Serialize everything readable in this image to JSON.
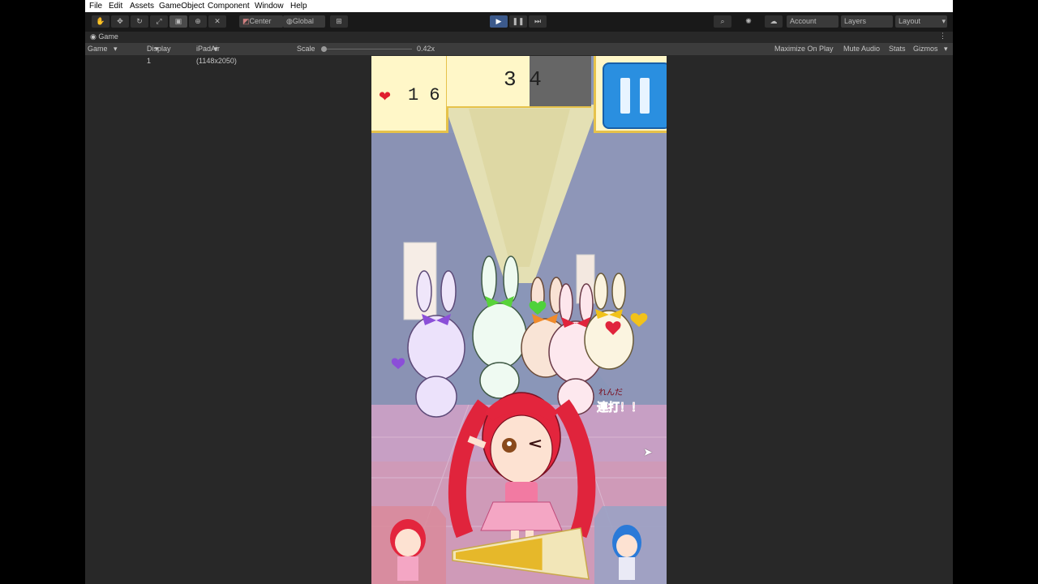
{
  "menu": [
    "File",
    "Edit",
    "Assets",
    "GameObject",
    "Component",
    "Window",
    "Help"
  ],
  "toolbar": {
    "pivot_label": "Center",
    "space_label": "Global",
    "account_label": "Account",
    "layers_label": "Layers",
    "layout_label": "Layout"
  },
  "game_view": {
    "tab_label": "Game",
    "view_select": "Game",
    "display_select": "Display 1",
    "resolution_select": "iPadAir (1148x2050)",
    "scale_label": "Scale",
    "scale_value": "0.42x",
    "maximize_label": "Maximize On Play",
    "mute_label": "Mute Audio",
    "stats_label": "Stats",
    "gizmos_label": "Gizmos"
  },
  "hud": {
    "lives_count": "1 6",
    "score": "3 4",
    "combo_text_top": "れんだ",
    "combo_text_main": "連打！！",
    "tap_gauge_level": 0.7
  },
  "colors": {
    "accent_play": "#3c5a8c",
    "hud_panel": "#fff7c8",
    "pause_blue": "#2a8fe0",
    "heart_red": "#e0202e"
  }
}
